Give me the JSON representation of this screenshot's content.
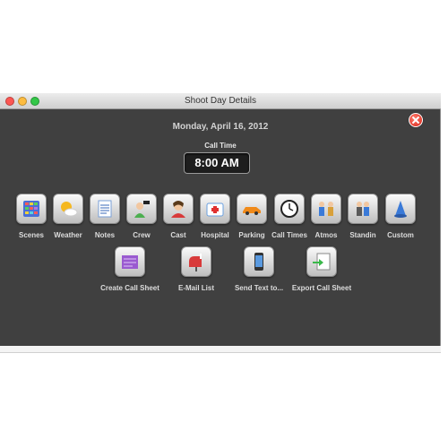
{
  "window": {
    "title": "Shoot Day Details"
  },
  "date": "Monday, April 16, 2012",
  "call_time": {
    "label": "Call Time",
    "value": "8:00 AM"
  },
  "icon_row": [
    {
      "label": "Scenes",
      "icon": "scenes-icon"
    },
    {
      "label": "Weather",
      "icon": "weather-icon"
    },
    {
      "label": "Notes",
      "icon": "notes-icon"
    },
    {
      "label": "Crew",
      "icon": "crew-icon"
    },
    {
      "label": "Cast",
      "icon": "cast-icon"
    },
    {
      "label": "Hospital",
      "icon": "hospital-icon"
    },
    {
      "label": "Parking",
      "icon": "parking-icon"
    },
    {
      "label": "Call Times",
      "icon": "clock-icon"
    },
    {
      "label": "Atmos",
      "icon": "atmos-icon"
    },
    {
      "label": "Standin",
      "icon": "standin-icon"
    },
    {
      "label": "Custom",
      "icon": "custom-icon"
    }
  ],
  "action_row": [
    {
      "label": "Create Call Sheet",
      "icon": "call-sheet-icon"
    },
    {
      "label": "E-Mail List",
      "icon": "mailbox-icon"
    },
    {
      "label": "Send Text to...",
      "icon": "phone-icon"
    },
    {
      "label": "Export Call Sheet",
      "icon": "export-icon"
    }
  ]
}
